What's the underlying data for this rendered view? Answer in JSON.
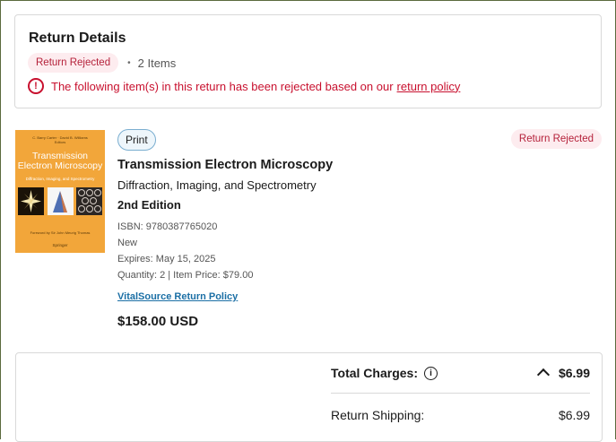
{
  "return_details": {
    "heading": "Return Details",
    "status_badge": "Return Rejected",
    "separator": "•",
    "items_count": "2 Items",
    "warning_text": "The following item(s) in this return has been rejected based on our",
    "warning_link": "return policy"
  },
  "item": {
    "format_badge": "Print",
    "status_badge": "Return Rejected",
    "title": "Transmission Electron Microscopy",
    "subtitle": "Diffraction, Imaging, and Spectrometry",
    "edition": "2nd Edition",
    "isbn": "ISBN: 9780387765020",
    "condition": "New",
    "expires": "Expires: May 15, 2025",
    "quantity_price": "Quantity: 2 | Item Price: $79.00",
    "policy_link": "VitalSource Return Policy",
    "total_price": "$158.00 USD",
    "cover": {
      "authors": "C. Barry Carter · David B. Williams\nEditors",
      "title": "Transmission Electron Microscopy",
      "subtitle": "Diffraction, Imaging, and Spectrometry",
      "foreword": "Foreword by Sir John Meurig Thomas",
      "publisher": "Springer",
      "background_color": "#f2a63a"
    }
  },
  "charges": {
    "total_label": "Total Charges:",
    "total_value": "$6.99",
    "shipping_label": "Return Shipping:",
    "shipping_value": "$6.99"
  },
  "icons": {
    "warning": "exclamation-circle-icon",
    "info": "info-circle-icon",
    "chevron": "chevron-up-icon"
  },
  "colors": {
    "rejected_text": "#c8102e",
    "rejected_bg": "#fdecef",
    "link": "#1b6fa5"
  }
}
